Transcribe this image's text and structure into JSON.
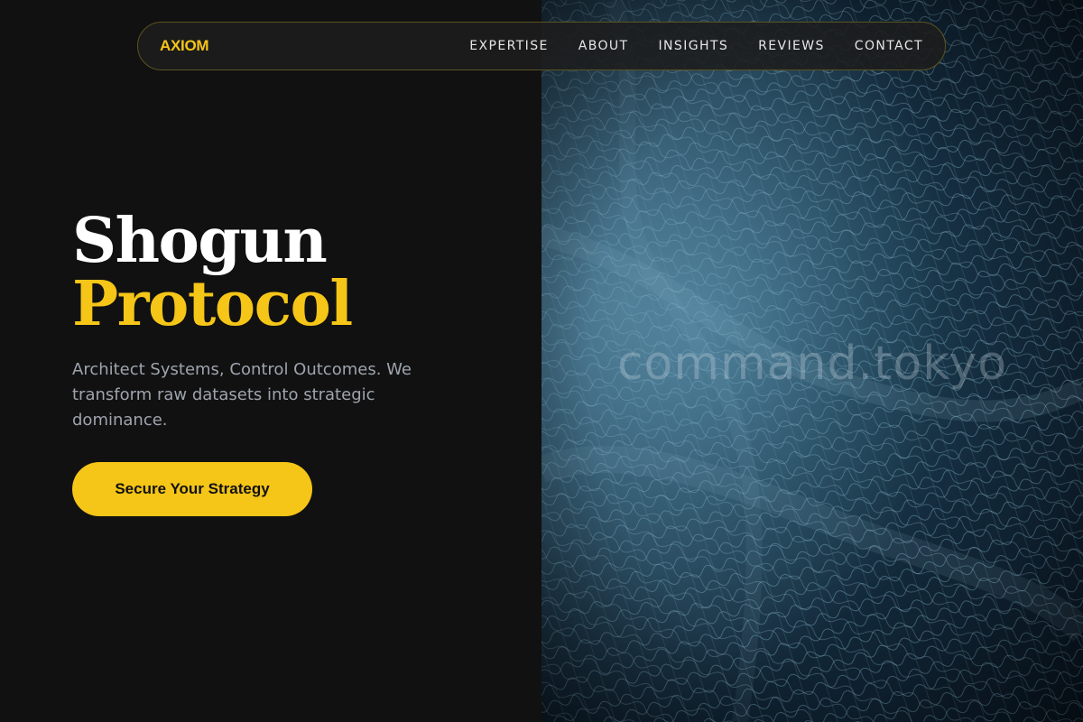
{
  "nav": {
    "logo": "AXIOM",
    "links": [
      "EXPERTISE",
      "ABOUT",
      "INSIGHTS",
      "REVIEWS",
      "CONTACT"
    ]
  },
  "hero": {
    "title_line1": "Shogun",
    "title_line2": "Protocol",
    "subtitle": "Architect Systems, Control Outcomes. We transform raw datasets into strategic dominance.",
    "cta_label": "Secure Your Strategy"
  },
  "visual": {
    "watermark": "command.tokyo"
  },
  "colors": {
    "accent": "#f5c518",
    "background": "#111111",
    "text_primary": "#ffffff",
    "text_secondary": "#9ea4ae",
    "image_tint": "#2e5a73"
  }
}
